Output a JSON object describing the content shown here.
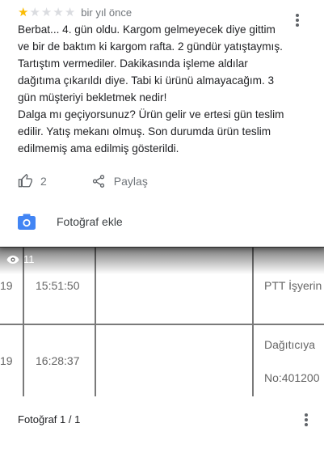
{
  "review": {
    "rating": 1,
    "max_rating": 5,
    "date": "bir yıl önce",
    "text_lines": [
      "Berbat... 4. gün oldu. Kargom gelmeyecek diye gittim",
      "ve bir de baktım ki kargom rafta. 2 gündür yatıştaymış.",
      "Tartıştım vermediler. Dakikasında işleme aldılar",
      "dağıtıma çıkarıldı diye. Tabi ki ürünü almayacağım. 3",
      "gün müşteriyi bekletmek nedir!",
      "Dalga mı geçiyorsunuz? Ürün gelir ve ertesi gün teslim",
      "edilir. Yatış mekanı olmuş. Son durumda ürün teslim",
      "edilmemiş ama edilmiş gösterildi."
    ],
    "like_count": "2",
    "share_label": "Paylaş",
    "add_photo_label": "Fotoğraf ekle"
  },
  "photo": {
    "view_count": "11",
    "table_rows": [
      {
        "date": "19",
        "time": "15:51:50",
        "description": "PTT İşyerin",
        "description2": ""
      },
      {
        "date": "19",
        "time": "16:28:37",
        "description": "Dağıtıcıya",
        "description2": "No:401200"
      }
    ]
  },
  "footer": {
    "photo_counter": "Fotoğraf 1 / 1"
  },
  "icons": {
    "star": "star-icon",
    "more": "more-vert-icon",
    "like": "thumb-up-icon",
    "share": "share-icon",
    "camera": "camera-icon",
    "eye": "eye-icon"
  },
  "colors": {
    "star_filled": "#fbbc04",
    "star_empty": "#dadce0",
    "camera_accent": "#4285f4"
  }
}
